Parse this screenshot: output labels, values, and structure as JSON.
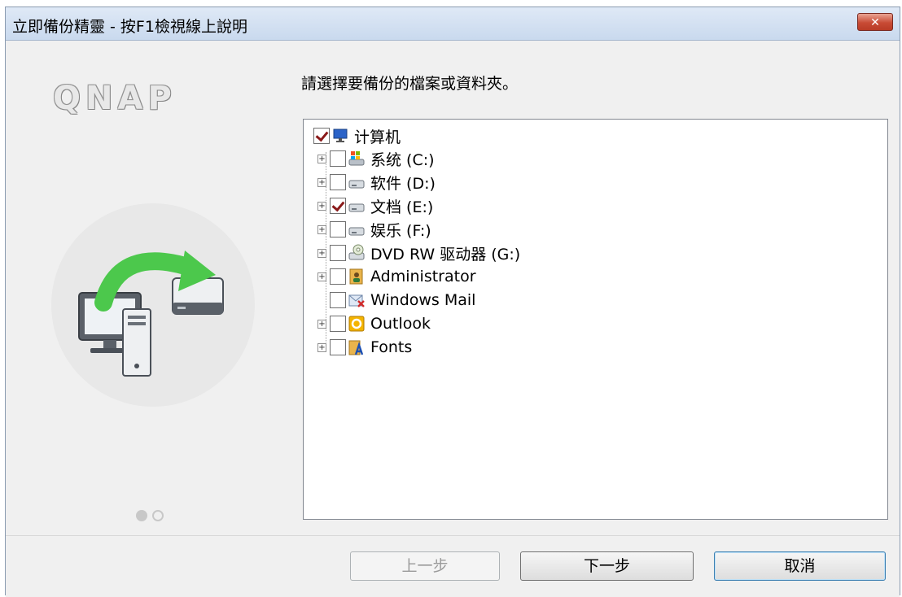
{
  "window": {
    "title": "立即備份精靈 - 按F1檢視線上說明",
    "close_label": "✕"
  },
  "branding": {
    "logo_text": "QNAP"
  },
  "instruction": "請選擇要備份的檔案或資料夾。",
  "tree": {
    "root": {
      "label": "计算机",
      "checked": true,
      "icon": "computer-icon"
    },
    "items": [
      {
        "label": "系统 (C:)",
        "checked": false,
        "expandable": true,
        "icon": "system-drive-icon"
      },
      {
        "label": "软件 (D:)",
        "checked": false,
        "expandable": true,
        "icon": "drive-icon"
      },
      {
        "label": "文档 (E:)",
        "checked": true,
        "expandable": true,
        "icon": "drive-icon"
      },
      {
        "label": "娱乐 (F:)",
        "checked": false,
        "expandable": true,
        "icon": "drive-icon"
      },
      {
        "label": "DVD RW 驱动器 (G:)",
        "checked": false,
        "expandable": true,
        "icon": "dvd-drive-icon"
      },
      {
        "label": "Administrator",
        "checked": false,
        "expandable": true,
        "icon": "user-folder-icon"
      },
      {
        "label": "Windows Mail",
        "checked": false,
        "expandable": false,
        "icon": "mail-icon"
      },
      {
        "label": "Outlook",
        "checked": false,
        "expandable": true,
        "icon": "outlook-icon"
      },
      {
        "label": "Fonts",
        "checked": false,
        "expandable": true,
        "icon": "fonts-folder-icon"
      }
    ]
  },
  "pager": {
    "pages": 2,
    "current": 1
  },
  "buttons": {
    "back": "上一步",
    "next": "下一步",
    "cancel": "取消"
  },
  "colors": {
    "check_mark": "#8a1a1a",
    "arrow_green": "#4cc84c",
    "close_red": "#c84b35"
  }
}
